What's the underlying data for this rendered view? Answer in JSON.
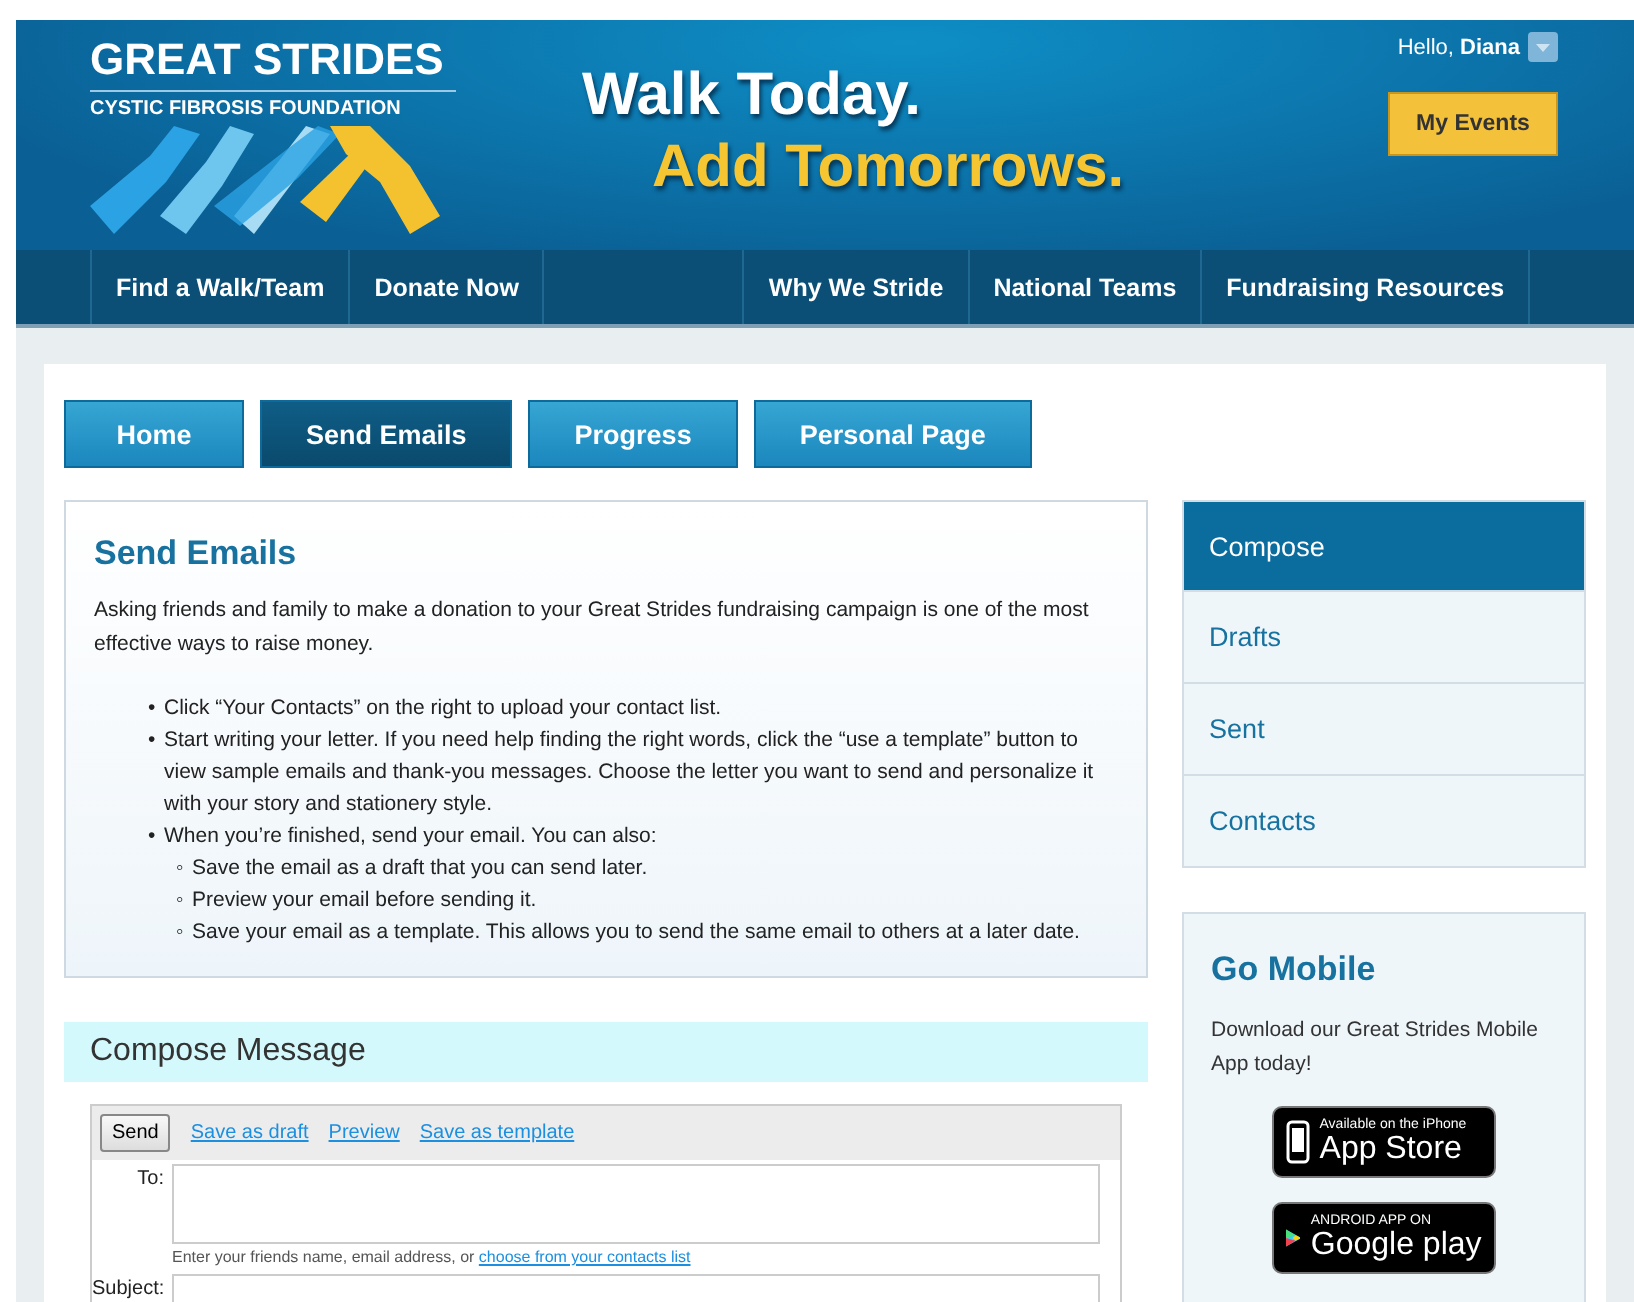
{
  "header": {
    "logo": {
      "title": "GREAT STRIDES",
      "subtitle": "CYSTIC FIBROSIS FOUNDATION"
    },
    "tagline": [
      "Walk Today.",
      "Add Tomorrows."
    ],
    "greeting": {
      "prefix": "Hello,",
      "name": "Diana"
    },
    "my_events_button": "My Events"
  },
  "nav": {
    "left": [
      "Find a Walk/Team",
      "Donate Now"
    ],
    "right": [
      "Why We Stride",
      "National Teams",
      "Fundraising Resources"
    ]
  },
  "tabs": [
    {
      "label": "Home",
      "selected": false
    },
    {
      "label": "Send Emails",
      "selected": true
    },
    {
      "label": "Progress",
      "selected": false
    },
    {
      "label": "Personal Page",
      "selected": false
    }
  ],
  "send_emails": {
    "title": "Send Emails",
    "intro": "Asking friends and family to make a donation to your Great Strides fundraising campaign is one of the most effective ways to raise money.",
    "bullets": [
      {
        "marker": "•",
        "text": "Click “Your Contacts” on the right to upload your contact list."
      },
      {
        "marker": "•",
        "text": "Start writing your letter. If you need help finding the right words, click the “use a template” button to view sample emails and thank-you messages. Choose the letter you want to send and personalize it with your story and stationery style."
      },
      {
        "marker": "•",
        "text": "When you’re finished, send your email. You can also:",
        "children": [
          {
            "marker": "◦",
            "text": "Save the email as a draft that you can send later."
          },
          {
            "marker": "◦",
            "text": "Preview your email before sending it."
          },
          {
            "marker": "◦",
            "text": "Save your email as a template. This allows you to send the same email to others at a later date."
          }
        ]
      }
    ]
  },
  "compose": {
    "title": "Compose Message",
    "send_button": "Send",
    "links": [
      "Save as draft",
      "Preview",
      "Save as template"
    ],
    "to_label": "To:",
    "to_hint": "Enter your friends name, email address, or",
    "to_hint_link": "choose from your contacts list",
    "subject_label": "Subject:"
  },
  "sidebar": {
    "items": [
      {
        "label": "Compose",
        "selected": true
      },
      {
        "label": "Drafts",
        "selected": false
      },
      {
        "label": "Sent",
        "selected": false
      },
      {
        "label": "Contacts",
        "selected": false
      }
    ]
  },
  "go_mobile": {
    "title": "Go Mobile",
    "text": "Download our Great Strides Mobile App today!",
    "badges": [
      {
        "kind": "apple",
        "small": "Available on the iPhone",
        "big": "App Store"
      },
      {
        "kind": "google",
        "small": "ANDROID APP ON",
        "big": "Google play"
      }
    ]
  }
}
